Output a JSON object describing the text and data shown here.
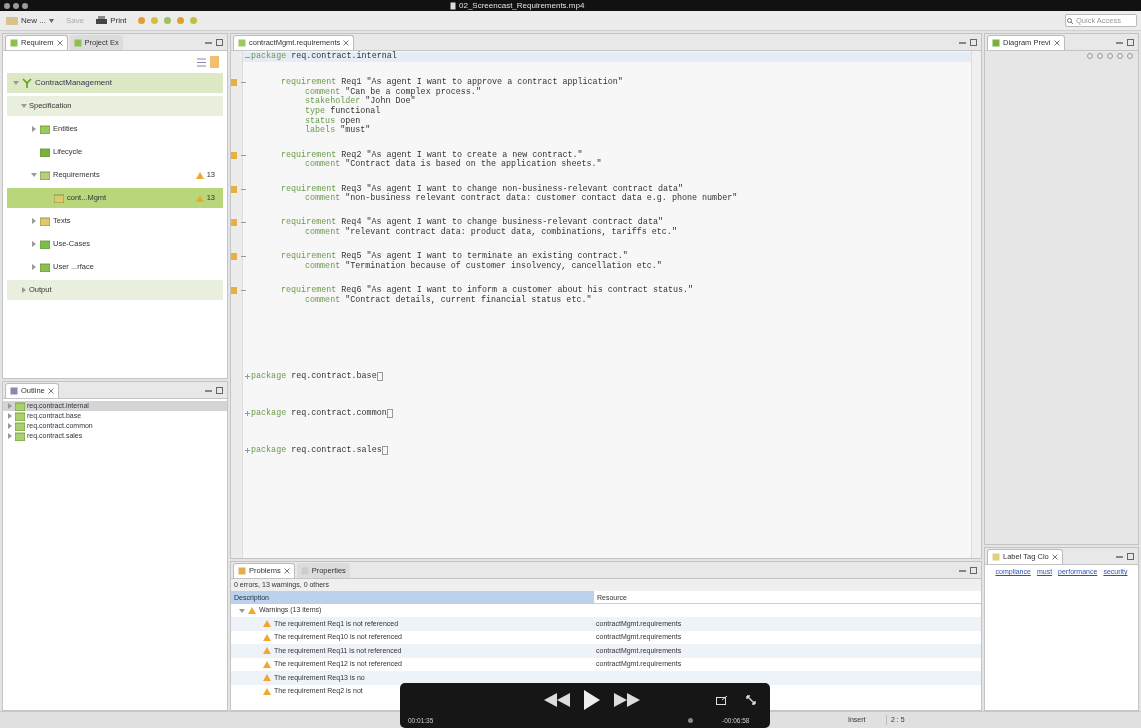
{
  "window": {
    "title": "02_Screencast_Requirements.mp4"
  },
  "toolbar": {
    "items": [
      {
        "kind": "dropdown",
        "label": "New ...",
        "disabled": false
      },
      {
        "kind": "button",
        "label": "Save",
        "disabled": true
      },
      {
        "kind": "button",
        "label": "Print",
        "disabled": false
      }
    ],
    "quick_access": {
      "placeholder": "Quick Access"
    }
  },
  "left_view": {
    "tabs": [
      {
        "label": "Requirem",
        "selected": true
      },
      {
        "label": "Project Ex",
        "selected": false
      }
    ],
    "root": {
      "label": "ContractManagement",
      "expanded": true
    },
    "sections": [
      {
        "title": "Specification",
        "expanded": true,
        "items": [
          {
            "label": "Entities",
            "expanded": false,
            "selected": false
          },
          {
            "label": "Lifecycle",
            "selected": false
          },
          {
            "label": "Requirements",
            "expanded": true,
            "selected": false,
            "badge": "13",
            "children": [
              {
                "label": "cont...Mgmt",
                "selected": true,
                "badge": "13"
              }
            ]
          },
          {
            "label": "Texts",
            "expanded": false,
            "selected": false
          },
          {
            "label": "Use-Cases",
            "expanded": false,
            "selected": false
          },
          {
            "label": "User ...rface",
            "expanded": false,
            "selected": false
          }
        ]
      },
      {
        "title": "Output",
        "expanded": false
      }
    ]
  },
  "outline": {
    "tab": "Outline",
    "items": [
      {
        "label": "req.contract.internal",
        "selected": true,
        "expanded": false
      },
      {
        "label": "req.contract.base",
        "selected": false,
        "expanded": false
      },
      {
        "label": "req.contract.common",
        "selected": false,
        "expanded": false
      },
      {
        "label": "req.contract.sales",
        "selected": false,
        "expanded": false
      }
    ]
  },
  "editor": {
    "tab": "contractMgmt.requirements",
    "blocks": [
      {
        "kind": "package",
        "keyword": "package",
        "name": "req.contract.internal",
        "expanded": true
      },
      {
        "kind": "requirement",
        "warning": true,
        "expanded": true,
        "lines": [
          {
            "keyword": "requirement",
            "text": "Req1 \"As agent I want to approve a contract application\""
          },
          {
            "keyword": "comment",
            "text": "\"Can be a complex process.\""
          },
          {
            "keyword": "stakeholder",
            "text": "\"John Doe\""
          },
          {
            "keyword": "type",
            "text": "functional"
          },
          {
            "keyword": "status",
            "text": "open"
          },
          {
            "keyword": "labels",
            "text": "\"must\""
          }
        ]
      },
      {
        "kind": "requirement",
        "warning": true,
        "expanded": true,
        "lines": [
          {
            "keyword": "requirement",
            "text": "Req2 \"As agent I want to create a new contract.\""
          },
          {
            "keyword": "comment",
            "text": "\"Contract data is based on the application sheets.\""
          }
        ]
      },
      {
        "kind": "requirement",
        "warning": true,
        "expanded": true,
        "lines": [
          {
            "keyword": "requirement",
            "text": "Req3 \"As agent I want to change non-business-relevant contract data\""
          },
          {
            "keyword": "comment",
            "text": "\"non-business relevant contract data: customer contact data e.g. phone number\""
          }
        ]
      },
      {
        "kind": "requirement",
        "warning": true,
        "expanded": true,
        "lines": [
          {
            "keyword": "requirement",
            "text": "Req4 \"As agent I want to change business-relevant contract data\""
          },
          {
            "keyword": "comment",
            "text": "\"relevant contract data: product data, combinations, tariffs etc.\""
          }
        ]
      },
      {
        "kind": "requirement",
        "warning": true,
        "expanded": true,
        "lines": [
          {
            "keyword": "requirement",
            "text": "Req5 \"As agent I want to terminate an existing contract.\""
          },
          {
            "keyword": "comment",
            "text": "\"Termination because of customer insolvency, cancellation etc.\""
          }
        ]
      },
      {
        "kind": "requirement",
        "warning": true,
        "expanded": true,
        "lines": [
          {
            "keyword": "requirement",
            "text": "Req6 \"As agent I want to inform a customer about his contract status.\""
          },
          {
            "keyword": "comment",
            "text": "\"Contract details, current financial status etc.\""
          }
        ]
      },
      {
        "kind": "package",
        "keyword": "package",
        "name": "req.contract.base",
        "expanded": false
      },
      {
        "kind": "package",
        "keyword": "package",
        "name": "req.contract.common",
        "expanded": false
      },
      {
        "kind": "package",
        "keyword": "package",
        "name": "req.contract.sales",
        "expanded": false
      }
    ]
  },
  "problems": {
    "tabs": [
      {
        "label": "Problems",
        "selected": true
      },
      {
        "label": "Properties",
        "selected": false
      }
    ],
    "summary": "0 errors, 13 warnings, 0 others",
    "columns": [
      "Description",
      "Resource"
    ],
    "group": {
      "label": "Warnings (13 items)",
      "expanded": true
    },
    "rows": [
      {
        "description": "The requirement Req1 is not referenced",
        "resource": "contractMgmt.requirements"
      },
      {
        "description": "The requirement Req10 is not referenced",
        "resource": "contractMgmt.requirements"
      },
      {
        "description": "The requirement Req11 is not referenced",
        "resource": "contractMgmt.requirements"
      },
      {
        "description": "The requirement Req12 is not referenced",
        "resource": "contractMgmt.requirements"
      },
      {
        "description": "The requirement Req13 is no"
      },
      {
        "description": "The requirement Req2 is not"
      }
    ]
  },
  "diagram_view": {
    "tab": "Diagram Previ"
  },
  "tag_cloud": {
    "tab": "Label Tag Clo",
    "tags": [
      "compliance",
      "must",
      "performance",
      "security"
    ]
  },
  "status_bar": {
    "mode": "Insert",
    "position": "2 : 5"
  },
  "video_controls": {
    "elapsed": "00:01:35",
    "remaining": "-00:06:58"
  }
}
